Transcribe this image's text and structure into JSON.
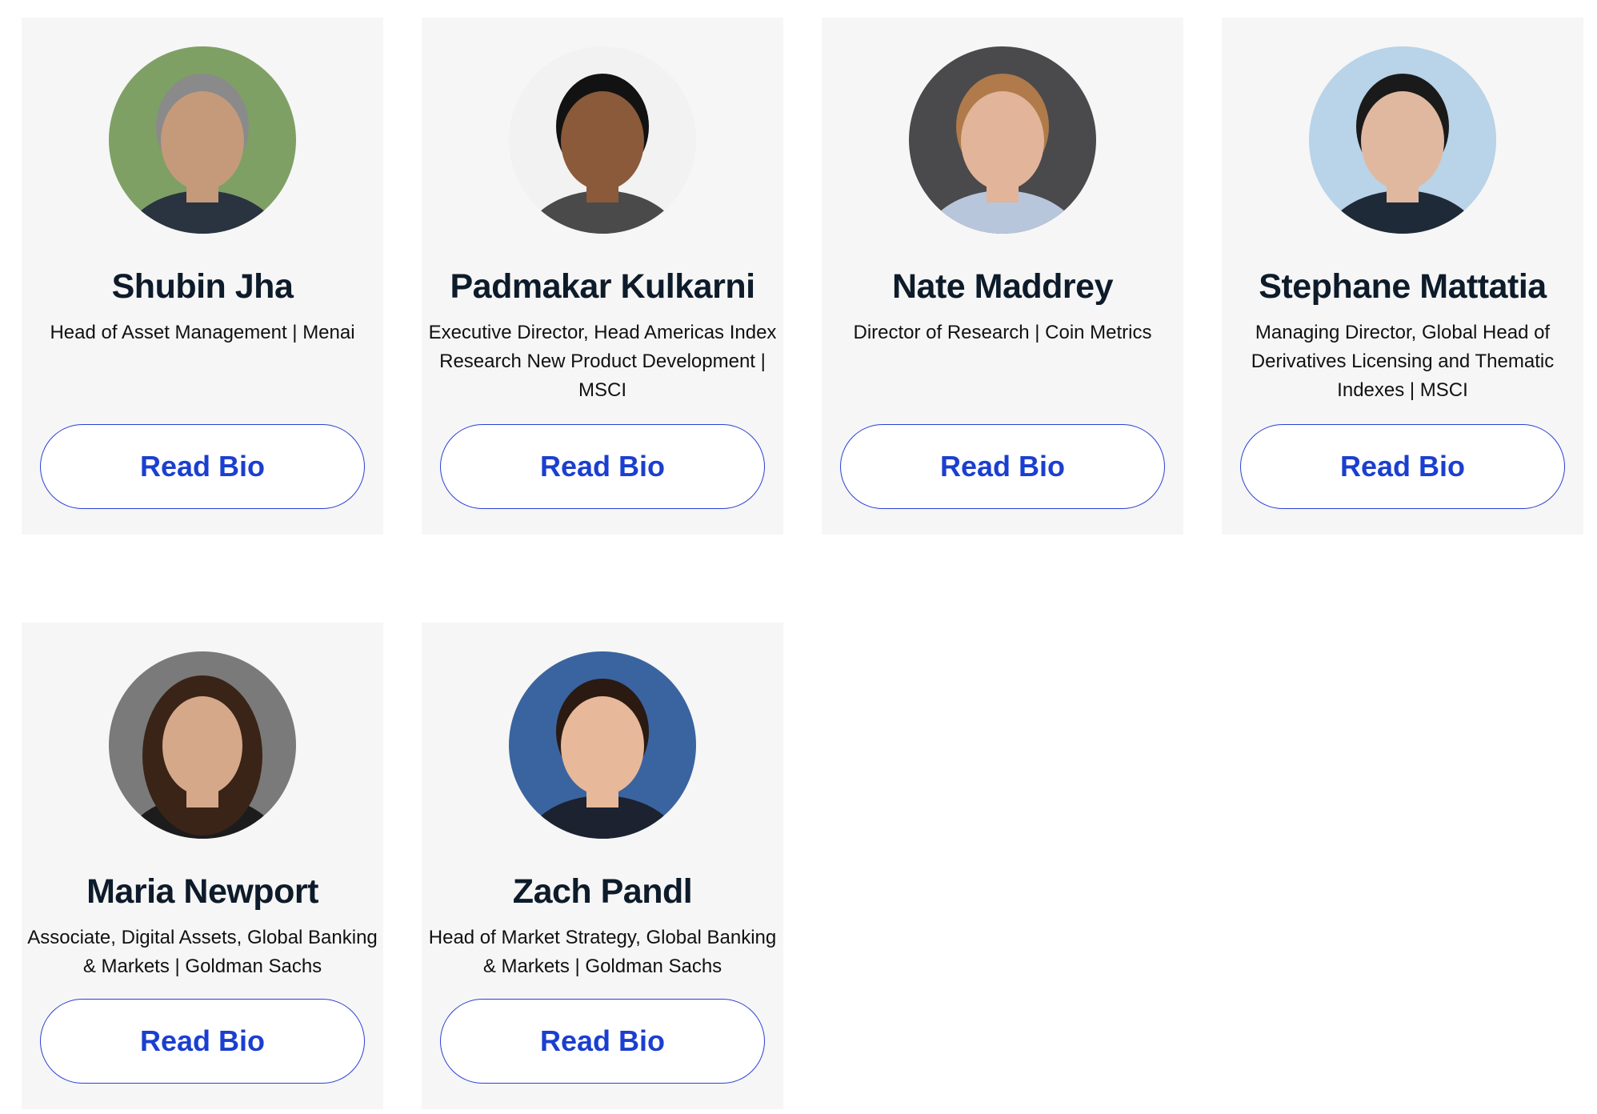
{
  "speakers": [
    {
      "name": "Shubin Jha",
      "title": "Head of Asset Management | Menai",
      "button": "Read Bio",
      "photo_bg": "#7fa064",
      "skin": "#c49a7a",
      "hair": "#8a8a8a",
      "shirt": "#2a3340"
    },
    {
      "name": "Padmakar Kulkarni",
      "title": "Executive Director, Head Americas Index Research New Product Development | MSCI",
      "button": "Read Bio",
      "photo_bg": "#f2f2f2",
      "skin": "#8a5a3a",
      "hair": "#121212",
      "shirt": "#4a4a4a"
    },
    {
      "name": "Nate Maddrey",
      "title": "Director of Research | Coin Metrics",
      "button": "Read Bio",
      "photo_bg": "#4a4a4c",
      "skin": "#e2b49a",
      "hair": "#b07a4a",
      "shirt": "#b8c6dc"
    },
    {
      "name": "Stephane Mattatia",
      "title": "Managing Director, Global Head of Derivatives Licensing and Thematic Indexes | MSCI",
      "button": "Read Bio",
      "photo_bg": "#b9d3e8",
      "skin": "#e0b8a0",
      "hair": "#1a1a1a",
      "shirt": "#1f2a38"
    },
    {
      "name": "Maria Newport",
      "title": "Associate, Digital Assets, Global Banking & Markets | Goldman Sachs",
      "button": "Read Bio",
      "photo_bg": "#7a7a7a",
      "skin": "#d6a88a",
      "hair": "#3a2418",
      "shirt": "#1c1c1c"
    },
    {
      "name": "Zach Pandl",
      "title": "Head of Market Strategy, Global Banking & Markets | Goldman Sachs",
      "button": "Read Bio",
      "photo_bg": "#3a64a0",
      "skin": "#e8b89a",
      "hair": "#2a1a12",
      "shirt": "#1c2230"
    }
  ]
}
